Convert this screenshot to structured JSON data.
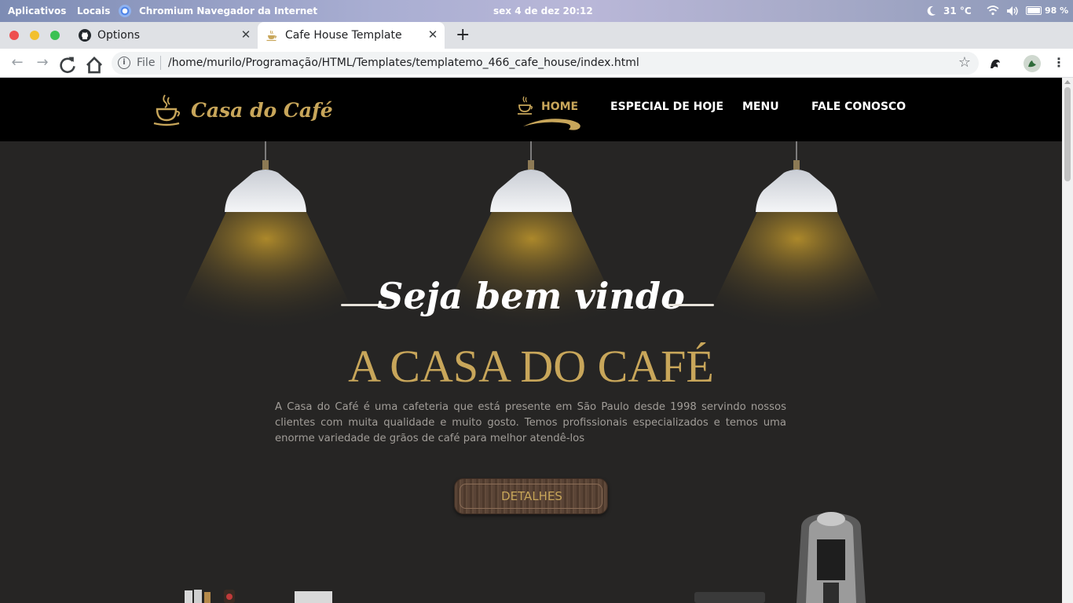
{
  "os_bar": {
    "apps": "Aplicativos",
    "places": "Locais",
    "active_app": "Chromium Navegador da Internet",
    "clock": "sex 4 de dez  20:12",
    "temperature": "31 °C",
    "battery": "98 %"
  },
  "tabs": [
    {
      "label": "Options",
      "icon": "github-icon"
    },
    {
      "label": "Cafe House Template",
      "icon": "coffee-cup-icon"
    }
  ],
  "omnibox": {
    "scheme": "File",
    "url": "/home/murilo/Programação/HTML/Templates/templatemo_466_cafe_house/index.html"
  },
  "site": {
    "logo": "Casa do Café",
    "nav": [
      {
        "label": "HOME",
        "active": true
      },
      {
        "label": "ESPECIAL DE HOJE",
        "active": false
      },
      {
        "label": "MENU",
        "active": false
      },
      {
        "label": "FALE CONOSCO",
        "active": false
      }
    ],
    "hero": {
      "welcome": "Seja bem vindo",
      "title": "A CASA DO CAFÉ",
      "description": "A Casa do Café é uma cafeteria que está presente em São Paulo desde 1998 servindo nossos clientes com muita qualidade e muito gosto. Temos profissionais especializados e temos uma enorme variedade de grãos de café para melhor atendê-los",
      "button": "DETALHES"
    }
  },
  "colors": {
    "accent_gold": "#c8a65a",
    "page_bg": "#262524",
    "header_bg": "#000000"
  }
}
